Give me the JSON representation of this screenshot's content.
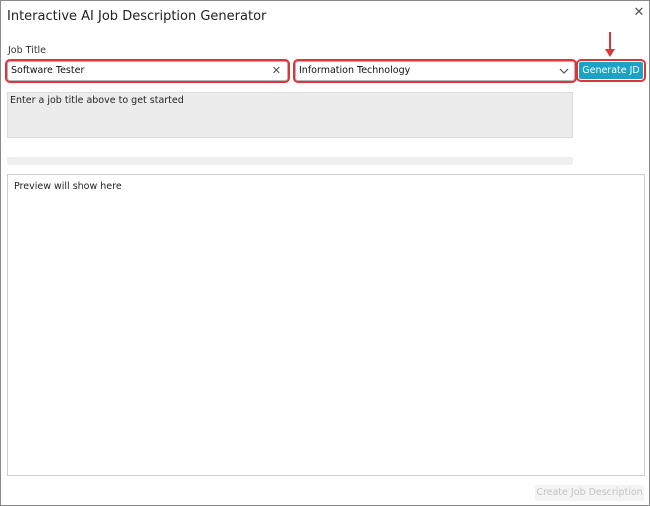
{
  "dialog": {
    "title": "Interactive AI Job Description Generator",
    "close_icon": "close-icon"
  },
  "form": {
    "job_title_label": "Job Title",
    "job_title_value": "Software Tester",
    "clear_icon": "clear-icon",
    "department_value": "Information Technology",
    "dropdown_icon": "chevron-down-icon",
    "generate_label": "Generate JD"
  },
  "hint": {
    "text": "Enter a job title above to get started"
  },
  "progress": {
    "fraction": 0
  },
  "preview": {
    "text": "Preview will show here"
  },
  "footer": {
    "create_label": "Create Job Description",
    "create_enabled": false
  },
  "colors": {
    "accent": "#1aa3c7",
    "highlight": "#e0343c",
    "disabled_text": "#c2c2c2"
  }
}
